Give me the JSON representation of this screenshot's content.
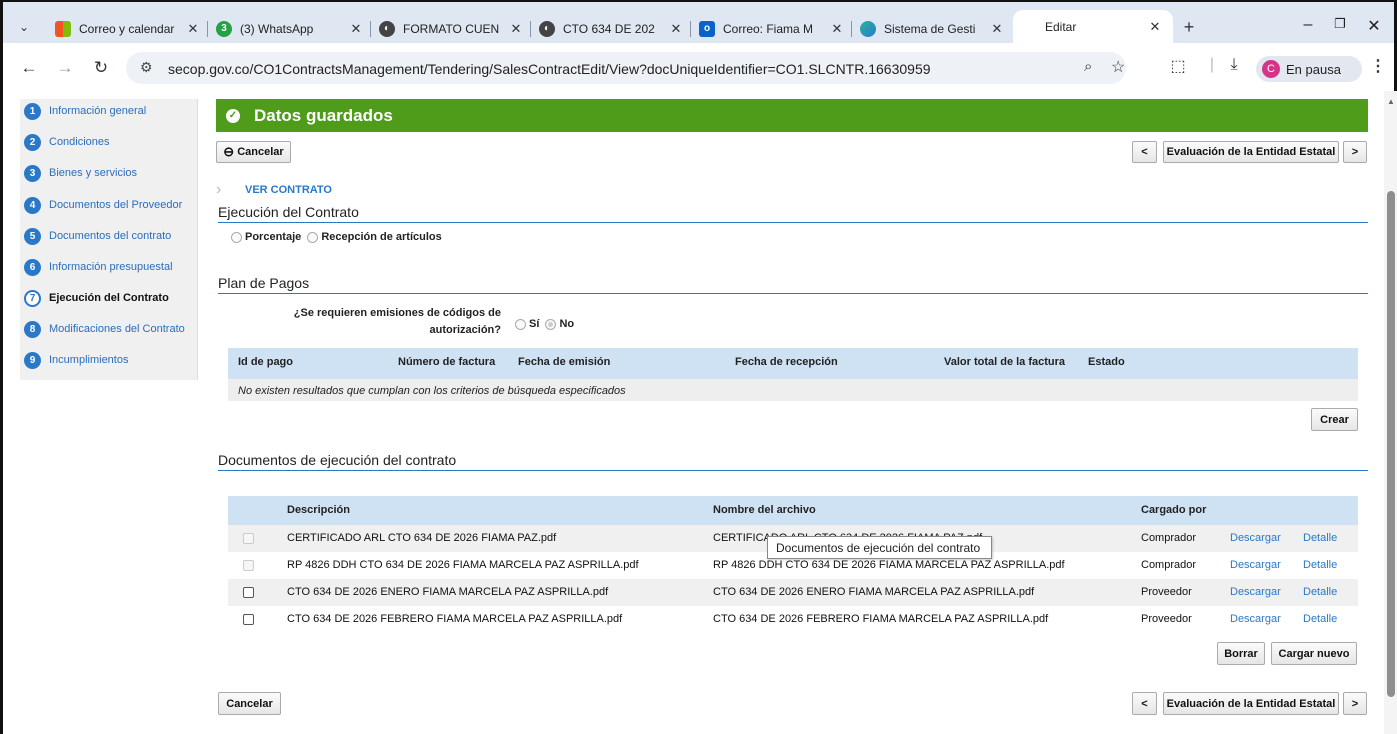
{
  "browser": {
    "tabs": [
      {
        "title": "Correo y calendar",
        "icon": "microsoft-icon"
      },
      {
        "title": "(3) WhatsApp",
        "icon": "whatsapp-icon"
      },
      {
        "title": "FORMATO CUEN",
        "icon": "globe-icon"
      },
      {
        "title": "CTO 634 DE 202",
        "icon": "globe-icon"
      },
      {
        "title": "Correo: Fiama M",
        "icon": "outlook-icon"
      },
      {
        "title": "Sistema de Gesti",
        "icon": "app-icon"
      },
      {
        "title": "Editar",
        "icon": "none"
      }
    ],
    "url": "secop.gov.co/CO1ContractsManagement/Tendering/SalesContractEdit/View?docUniqueIdentifier=CO1.SLCNTR.16630959",
    "profile_initial": "C",
    "profile_label": "En pausa"
  },
  "sidebar": {
    "items": [
      {
        "num": "1",
        "label": "Información general"
      },
      {
        "num": "2",
        "label": "Condiciones"
      },
      {
        "num": "3",
        "label": "Bienes y servicios"
      },
      {
        "num": "4",
        "label": "Documentos del Proveedor"
      },
      {
        "num": "5",
        "label": "Documentos del contrato"
      },
      {
        "num": "6",
        "label": "Información presupuestal"
      },
      {
        "num": "7",
        "label": "Ejecución del Contrato"
      },
      {
        "num": "8",
        "label": "Modificaciones del Contrato"
      },
      {
        "num": "9",
        "label": "Incumplimientos"
      }
    ]
  },
  "banner": {
    "text": "Datos guardados"
  },
  "top_actions": {
    "cancel": "Cancelar",
    "prev": "<",
    "next_step": "Evaluación de la Entidad Estatal",
    "next": ">"
  },
  "ver_contrato": "VER CONTRATO",
  "ejecucion": {
    "title": "Ejecución del Contrato",
    "opt1": "Porcentaje",
    "opt2": "Recepción de artículos"
  },
  "plan_pagos": {
    "title": "Plan de Pagos",
    "question_l1": "¿Se requieren emisiones de códigos de",
    "question_l2": "autorización?",
    "yes": "Sí",
    "no": "No",
    "headers": [
      "Id de pago",
      "Número de factura",
      "Fecha de emisión",
      "Fecha de recepción",
      "Valor total de la factura",
      "Estado"
    ],
    "empty": "No existen resultados que cumplan con los criterios de búsqueda especificados",
    "create": "Crear"
  },
  "documentos": {
    "title": "Documentos de ejecución del contrato",
    "headers": [
      "Descripción",
      "Nombre del archivo",
      "Cargado por"
    ],
    "rows": [
      {
        "desc": "CERTIFICADO ARL CTO 634 DE 2026 FIAMA PAZ.pdf",
        "file": "CERTIFICADO ARL CTO 634 DE 2026 FIAMA PAZ.pdf",
        "by": "Comprador",
        "download": "Descargar",
        "detail": "Detalle"
      },
      {
        "desc": "RP 4826 DDH CTO 634 DE 2026 FIAMA MARCELA PAZ ASPRILLA.pdf",
        "file": "RP 4826 DDH CTO 634 DE 2026 FIAMA MARCELA PAZ ASPRILLA.pdf",
        "by": "Comprador",
        "download": "Descargar",
        "detail": "Detalle"
      },
      {
        "desc": "CTO 634 DE 2026 ENERO FIAMA MARCELA PAZ ASPRILLA.pdf",
        "file": "CTO 634 DE 2026 ENERO FIAMA MARCELA PAZ ASPRILLA.pdf",
        "by": "Proveedor",
        "download": "Descargar",
        "detail": "Detalle"
      },
      {
        "desc": "CTO 634 DE 2026 FEBRERO FIAMA MARCELA PAZ ASPRILLA.pdf",
        "file": "CTO 634 DE 2026 FEBRERO FIAMA MARCELA PAZ ASPRILLA.pdf",
        "by": "Proveedor",
        "download": "Descargar",
        "detail": "Detalle"
      }
    ],
    "tooltip": "Documentos de ejecución del contrato",
    "delete": "Borrar",
    "upload": "Cargar nuevo"
  },
  "bottom_actions": {
    "cancel": "Cancelar",
    "prev": "<",
    "next_step": "Evaluación de la Entidad Estatal",
    "next": ">"
  }
}
